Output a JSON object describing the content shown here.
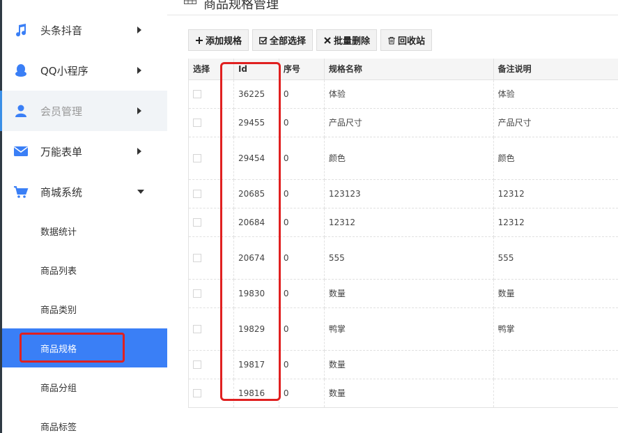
{
  "sidebar": {
    "items": [
      {
        "label": "头条抖音",
        "icon": "music-note-icon",
        "color": "#3a7ff6"
      },
      {
        "label": "QQ小程序",
        "icon": "qq-penguin-icon",
        "color": "#3a7ff6"
      },
      {
        "label": "会员管理",
        "icon": "user-icon",
        "color": "#3a7ff6"
      },
      {
        "label": "万能表单",
        "icon": "envelope-icon",
        "color": "#3a7ff6"
      },
      {
        "label": "商城系统",
        "icon": "shopping-cart-icon",
        "color": "#3a7ff6"
      }
    ],
    "subitems": [
      {
        "label": "数据统计"
      },
      {
        "label": "商品列表"
      },
      {
        "label": "商品类别"
      },
      {
        "label": "商品规格"
      },
      {
        "label": "商品分组"
      },
      {
        "label": "商品标签"
      }
    ],
    "active_color": "#3a7ff6"
  },
  "header": {
    "title": "商品规格管理",
    "icon": "grid-icon"
  },
  "toolbar": {
    "add_label": "添加规格",
    "select_all_label": "全部选择",
    "batch_delete_label": "批量删除",
    "recycle_label": "回收站"
  },
  "table": {
    "columns": [
      "选择",
      "Id",
      "序号",
      "规格名称",
      "备注说明"
    ],
    "rows": [
      {
        "id": "36225",
        "seq": "0",
        "name": "体验",
        "note": "体验"
      },
      {
        "id": "29455",
        "seq": "0",
        "name": "产品尺寸",
        "note": "产品尺寸"
      },
      {
        "id": "29454",
        "seq": "0",
        "name": "颜色",
        "note": "颜色"
      },
      {
        "id": "20685",
        "seq": "0",
        "name": "123123",
        "note": "12312"
      },
      {
        "id": "20684",
        "seq": "0",
        "name": "12312",
        "note": "12312"
      },
      {
        "id": "20674",
        "seq": "0",
        "name": "555",
        "note": "555"
      },
      {
        "id": "19830",
        "seq": "0",
        "name": "数量",
        "note": "数量"
      },
      {
        "id": "19829",
        "seq": "0",
        "name": "鸭掌",
        "note": "鸭掌"
      },
      {
        "id": "19817",
        "seq": "0",
        "name": "数量",
        "note": ""
      },
      {
        "id": "19816",
        "seq": "0",
        "name": "数量",
        "note": ""
      }
    ]
  },
  "highlight_color": "#e02020"
}
